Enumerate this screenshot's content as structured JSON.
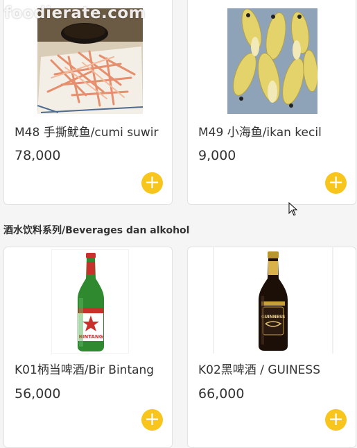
{
  "watermark": "foodierate.com",
  "section_title": "酒水饮料系列/Beverages dan alkohol",
  "products": [
    {
      "name": "M48 手撕鱿鱼/cumi suwir",
      "price": "78,000",
      "image": "dried-squid-strips"
    },
    {
      "name": "M49 小海鱼/ikan kecil",
      "price": "9,000",
      "image": "small-yellow-fish"
    },
    {
      "name": "K01柄当啤酒/Bir Bintang",
      "price": "56,000",
      "image": "bintang-beer-bottle"
    },
    {
      "name": "K02黑啤酒 / GUINESS",
      "price": "66,000",
      "image": "guinness-beer-bottle"
    }
  ],
  "add_symbol": "+",
  "colors": {
    "accent": "#f7c51c",
    "card_bg": "#ffffff",
    "page_bg": "#f5f5f5"
  }
}
